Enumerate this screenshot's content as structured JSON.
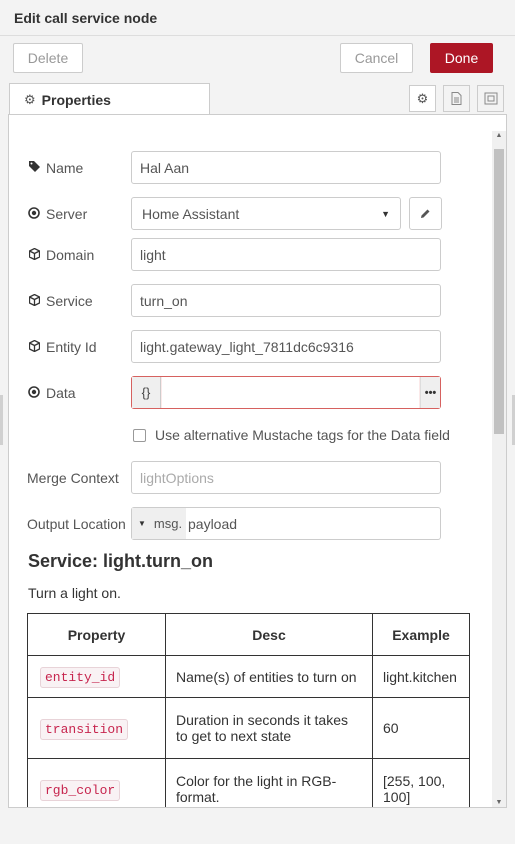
{
  "dialog": {
    "title": "Edit call service node",
    "delete_label": "Delete",
    "cancel_label": "Cancel",
    "done_label": "Done",
    "accent_color": "#ad1625"
  },
  "tabs": {
    "properties_label": "Properties",
    "icons": [
      "gear-icon",
      "document-icon",
      "frame-icon"
    ]
  },
  "form": {
    "name": {
      "label": "Name",
      "value": "Hal Aan"
    },
    "server": {
      "label": "Server",
      "value": "Home Assistant"
    },
    "domain": {
      "label": "Domain",
      "value": "light"
    },
    "service": {
      "label": "Service",
      "value": "turn_on"
    },
    "entity_id": {
      "label": "Entity Id",
      "value": "light.gateway_light_7811dc6c9316"
    },
    "data": {
      "label": "Data",
      "type_label": "{}",
      "value": "",
      "more_label": "•••"
    },
    "mustache": {
      "label": "Use alternative Mustache tags for the Data field",
      "checked": false
    },
    "merge_context": {
      "label": "Merge Context",
      "placeholder": "lightOptions"
    },
    "output_location": {
      "label": "Output Location",
      "type_label": "msg.",
      "value": "payload"
    }
  },
  "docs": {
    "title": "Service: light.turn_on",
    "description": "Turn a light on.",
    "headers": [
      "Property",
      "Desc",
      "Example"
    ],
    "rows": [
      {
        "property": "entity_id",
        "desc": "Name(s) of entities to turn on",
        "example": "light.kitchen"
      },
      {
        "property": "transition",
        "desc": "Duration in seconds it takes to get to next state",
        "example": "60"
      },
      {
        "property": "rgb_color",
        "desc": "Color for the light in RGB-format.",
        "example": "[255, 100, 100]"
      }
    ]
  }
}
